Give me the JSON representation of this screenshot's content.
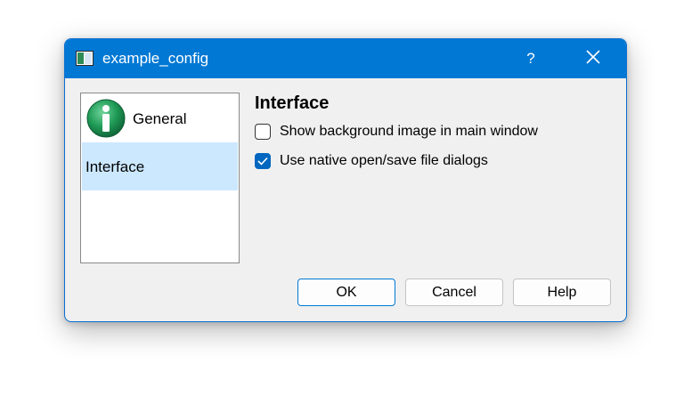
{
  "window": {
    "title": "example_config",
    "help_glyph": "?",
    "accent_color": "#0078d4"
  },
  "sidebar": {
    "items": [
      {
        "label": "General",
        "icon": "info-icon",
        "selected": false
      },
      {
        "label": "Interface",
        "selected": true
      }
    ]
  },
  "main": {
    "section_title": "Interface",
    "options": [
      {
        "label": "Show background image in main window",
        "checked": false
      },
      {
        "label": "Use native open/save file dialogs",
        "checked": true
      }
    ]
  },
  "buttons": {
    "ok_label": "OK",
    "cancel_label": "Cancel",
    "help_label": "Help"
  }
}
